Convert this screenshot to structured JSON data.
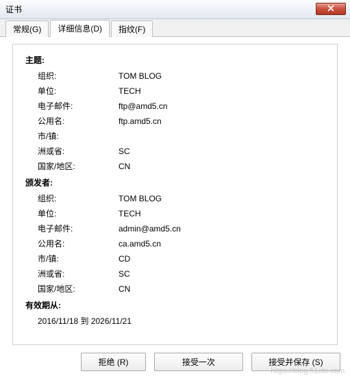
{
  "window": {
    "title": "证书"
  },
  "tabs": {
    "general": "常规(G)",
    "details": "详细信息(D)",
    "fingerprint": "指纹(F)"
  },
  "subject": {
    "heading": "主题:",
    "org_label": "组织:",
    "org_value": "TOM BLOG",
    "unit_label": "单位:",
    "unit_value": "TECH",
    "email_label": "电子邮件:",
    "email_value": "ftp@amd5.cn",
    "cn_label": "公用名:",
    "cn_value": "ftp.amd5.cn",
    "city_label": "市/镇:",
    "city_value": "",
    "state_label": "洲或省:",
    "state_value": "SC",
    "country_label": "国家/地区:",
    "country_value": "CN"
  },
  "issuer": {
    "heading": "颁发者:",
    "org_label": "组织:",
    "org_value": "TOM BLOG",
    "unit_label": "单位:",
    "unit_value": "TECH",
    "email_label": "电子邮件:",
    "email_value": "admin@amd5.cn",
    "cn_label": "公用名:",
    "cn_value": "ca.amd5.cn",
    "city_label": "市/镇:",
    "city_value": "CD",
    "state_label": "洲或省:",
    "state_value": "SC",
    "country_label": "国家/地区:",
    "country_value": "CN"
  },
  "validity": {
    "heading": "有效期从:",
    "range": "2016/11/18  到  2026/11/21"
  },
  "buttons": {
    "reject": "拒绝 (R)",
    "accept_once": "接受一次",
    "accept_save": "接受并保存 (S)"
  },
  "watermark": "https://blog.51cto.com"
}
